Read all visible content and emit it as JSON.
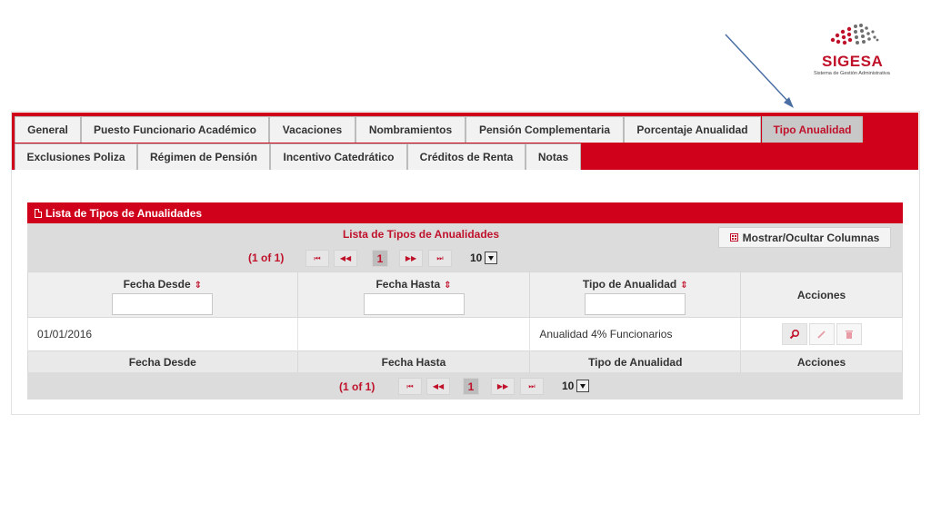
{
  "logo": {
    "brand": "SIGESA",
    "tagline": "Sistema de Gestión Administrativa"
  },
  "tabs": {
    "row1": [
      "General",
      "Puesto Funcionario Académico",
      "Vacaciones",
      "Nombramientos",
      "Pensión Complementaria",
      "Porcentaje Anualidad",
      "Tipo Anualidad"
    ],
    "row2": [
      "Exclusiones Poliza",
      "Régimen de Pensión",
      "Incentivo Catedrático",
      "Créditos de Renta",
      "Notas"
    ],
    "active": "Tipo Anualidad"
  },
  "panel": {
    "title": "Lista de Tipos de Anualidades",
    "caption": "Lista de Tipos de Anualidades",
    "toggle_columns_label": "Mostrar/Ocultar Columnas"
  },
  "paginator": {
    "count": "(1 of 1)",
    "first": "⏮",
    "prev": "◀◀",
    "current_page": "1",
    "next": "▶▶",
    "last": "⏭",
    "rows_per_page": "10"
  },
  "table": {
    "columns": [
      "Fecha Desde",
      "Fecha Hasta",
      "Tipo de Anualidad",
      "Acciones"
    ],
    "rows": [
      {
        "fecha_desde": "01/01/2016",
        "fecha_hasta": "",
        "tipo": "Anualidad 4% Funcionarios"
      }
    ]
  },
  "icons": {
    "view": "magnifier-icon",
    "edit": "pencil-icon",
    "delete": "trash-icon",
    "sort": "sort-icon",
    "columns": "grid-icon"
  },
  "colors": {
    "accent": "#d0021b",
    "active_tab_text": "#c0112b"
  }
}
